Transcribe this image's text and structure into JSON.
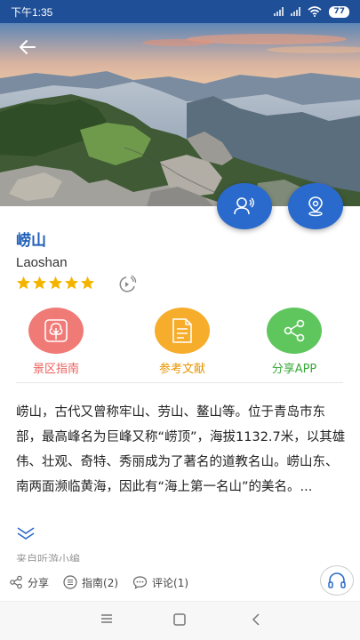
{
  "status": {
    "time": "下午1:35",
    "battery": "77"
  },
  "place": {
    "title": "崂山",
    "subtitle": "Laoshan",
    "rating": 5
  },
  "actions": {
    "guide": "景区指南",
    "reference": "参考文献",
    "share": "分享APP"
  },
  "description": "崂山，古代又曾称牢山、劳山、鳌山等。位于青岛市东部，最高峰名为巨峰又称“崂顶”，海拔1132.7米，以其雄伟、壮观、奇特、秀丽成为了著名的道教名山。崂山东、南两面濒临黄海，因此有“海上第一名山”的美名。...",
  "source": "来自听游小编",
  "toolbar": {
    "share": "分享",
    "guide": "指南(2)",
    "comment": "评论(1)"
  },
  "icons": {
    "back": "back-arrow-icon",
    "fab1": "person-voice-icon",
    "fab2": "location-pin-icon",
    "voice": "voice-play-icon",
    "guide": "tree-icon",
    "reference": "document-icon",
    "share": "share-icon",
    "expand": "double-chevron-down-icon",
    "listen": "headphones-icon"
  }
}
